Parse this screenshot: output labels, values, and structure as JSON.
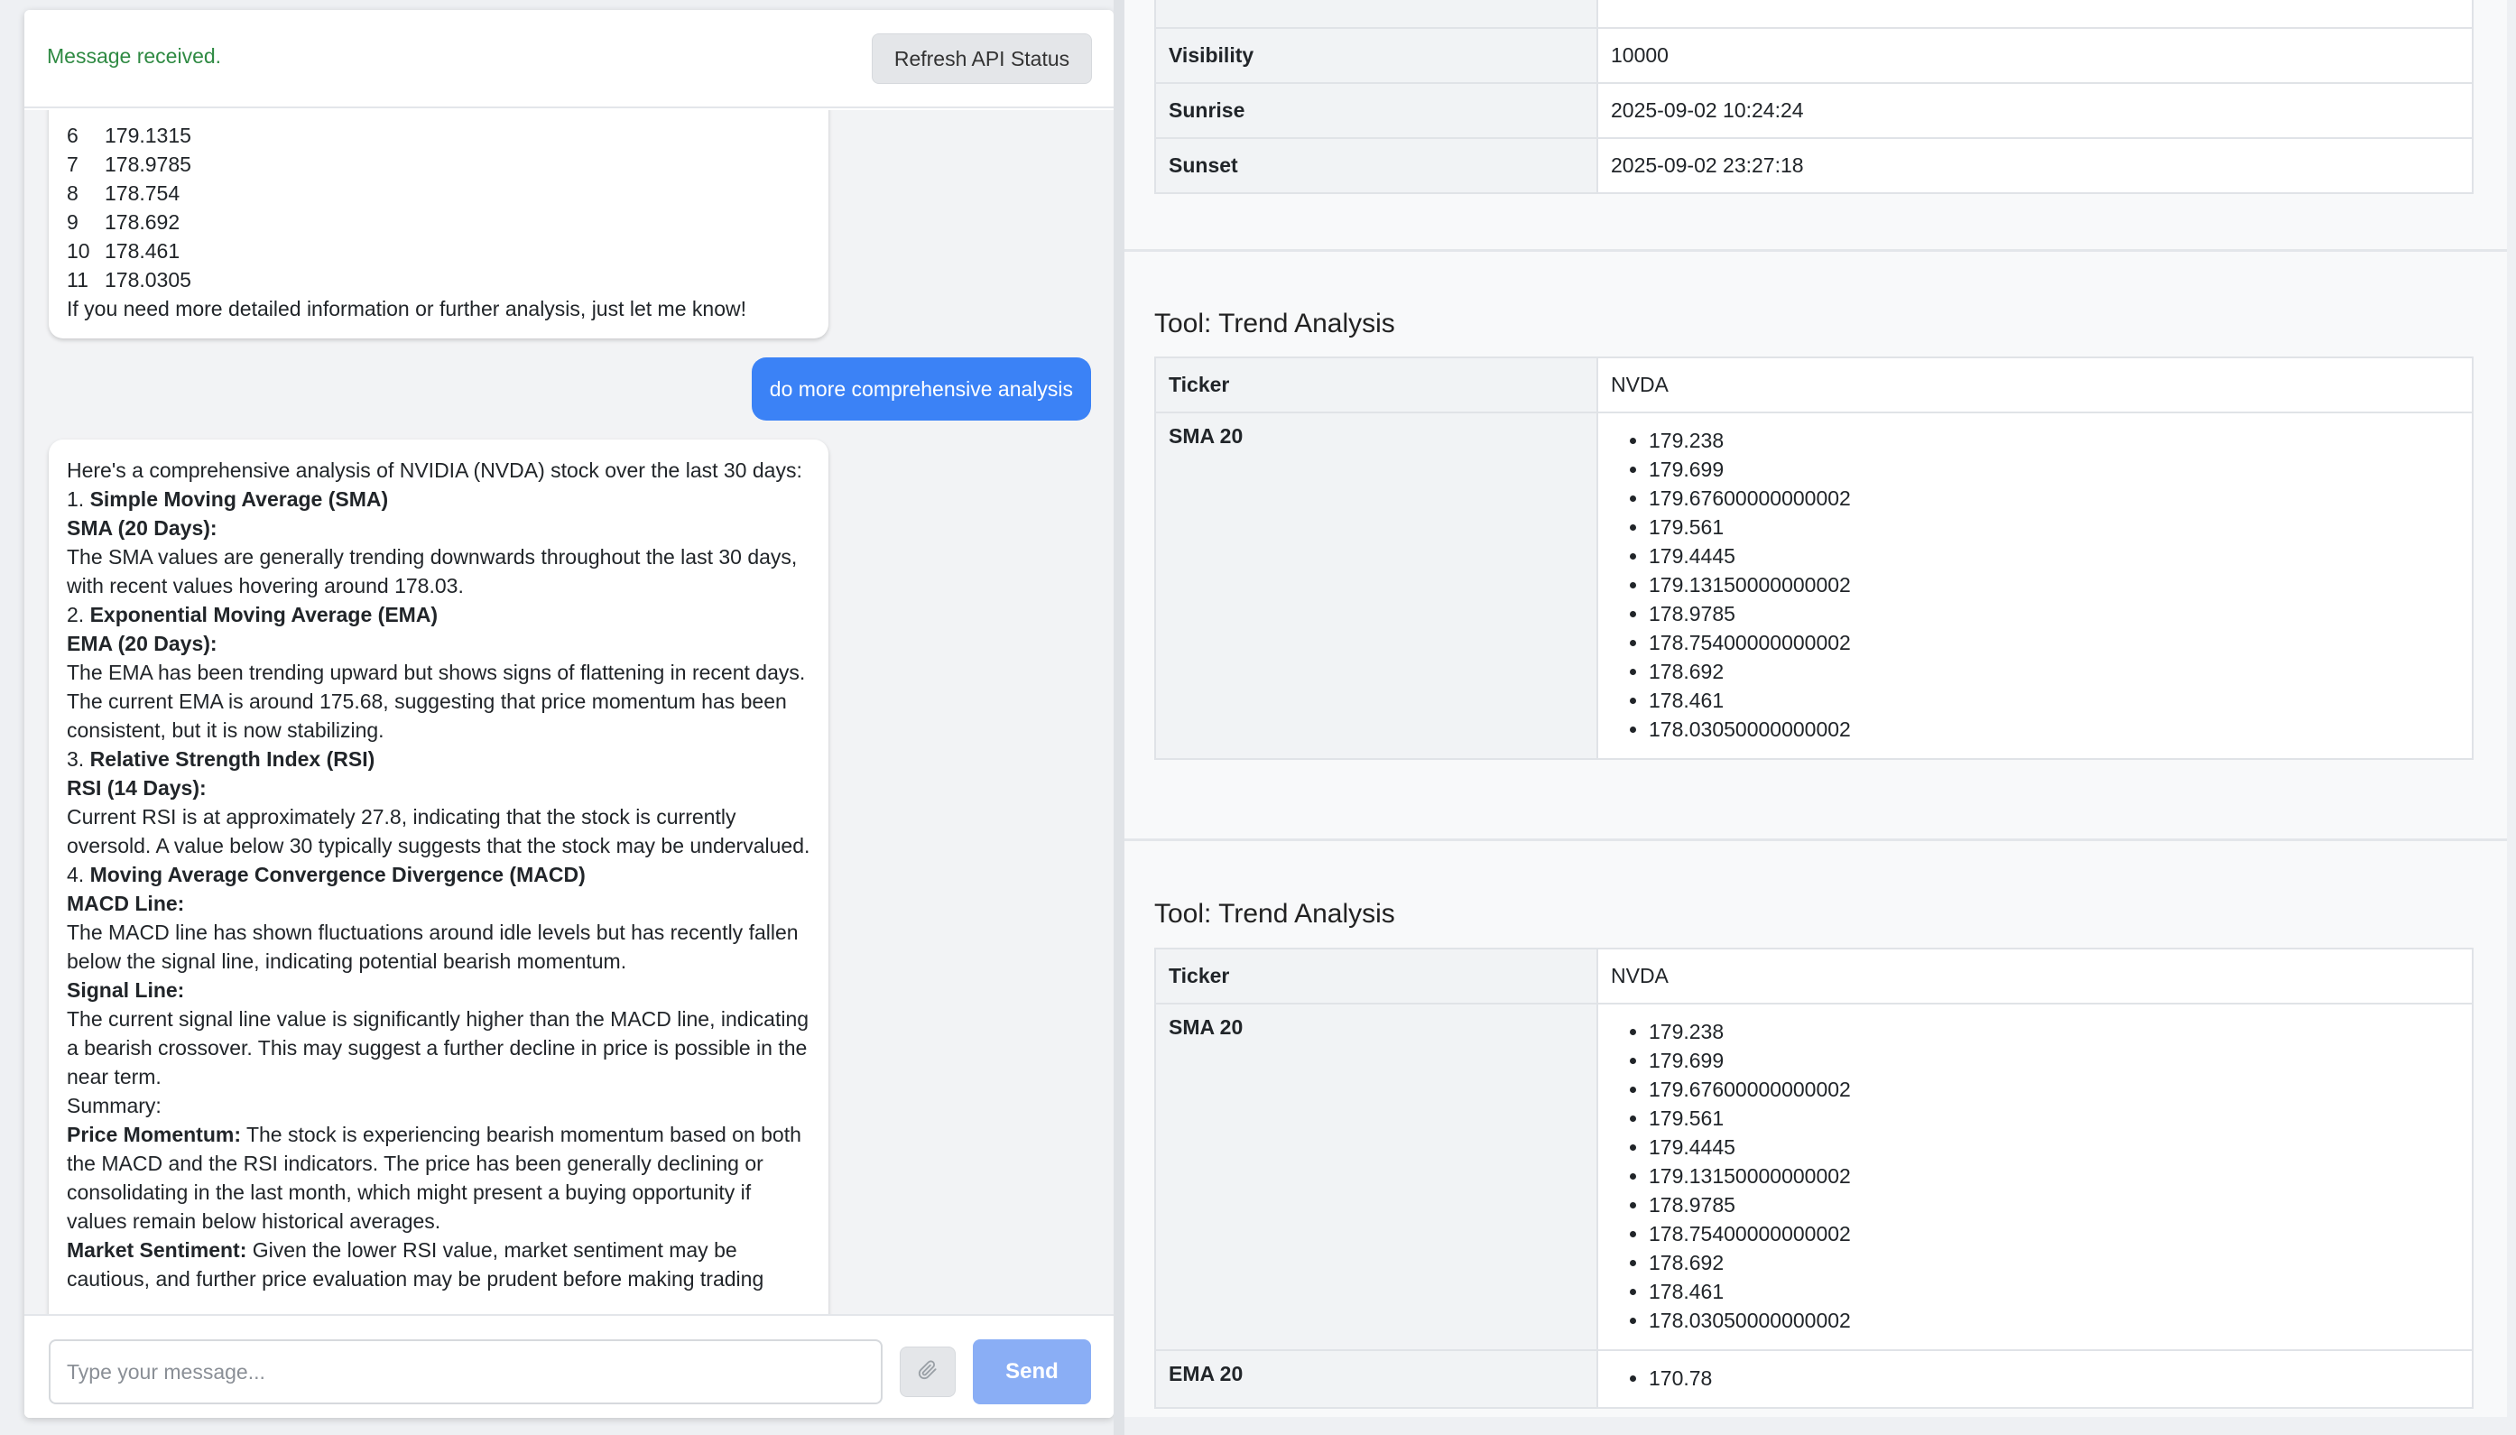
{
  "header": {
    "status_text": "Message received.",
    "refresh_label": "Refresh API Status"
  },
  "chat": {
    "bot1": {
      "rows": [
        {
          "idx": "6",
          "val": "179.1315"
        },
        {
          "idx": "7",
          "val": "178.9785"
        },
        {
          "idx": "8",
          "val": "178.754"
        },
        {
          "idx": "9",
          "val": "178.692"
        },
        {
          "idx": "10",
          "val": "178.461"
        },
        {
          "idx": "11",
          "val": "178.0305"
        }
      ],
      "closing": "If you need more detailed information or further analysis, just let me know!"
    },
    "user_message": "do more comprehensive analysis",
    "bot2": {
      "intro": "Here's a comprehensive analysis of NVIDIA (NVDA) stock over the last 30 days:",
      "s1_num": "1. ",
      "s1_title": "Simple Moving Average (SMA)",
      "s1_sub": "SMA (20 Days):",
      "s1_text": "The SMA values are generally trending downwards throughout the last 30 days, with recent values hovering around 178.03.",
      "s2_num": "2. ",
      "s2_title": "Exponential Moving Average (EMA)",
      "s2_sub": "EMA (20 Days):",
      "s2_text": "The EMA has been trending upward but shows signs of flattening in recent days. The current EMA is around 175.68, suggesting that price momentum has been consistent, but it is now stabilizing.",
      "s3_num": "3. ",
      "s3_title": "Relative Strength Index (RSI)",
      "s3_sub": "RSI (14 Days):",
      "s3_text": "Current RSI is at approximately 27.8, indicating that the stock is currently oversold. A value below 30 typically suggests that the stock may be undervalued.",
      "s4_num": "4. ",
      "s4_title": "Moving Average Convergence Divergence (MACD)",
      "s4_sub1": "MACD Line:",
      "s4_text1": "The MACD line has shown fluctuations around idle levels but has recently fallen below the signal line, indicating potential bearish momentum.",
      "s4_sub2": "Signal Line:",
      "s4_text2": "The current signal line value is significantly higher than the MACD line, indicating a bearish crossover. This may suggest a further decline in price is possible in the near term.",
      "summary_label": "Summary:",
      "pm_label": "Price Momentum:",
      "pm_text": " The stock is experiencing bearish momentum based on both the MACD and the RSI indicators. The price has been generally declining or consolidating in the last month, which might present a buying opportunity if values remain below historical averages.",
      "ms_label": "Market Sentiment:",
      "ms_text": " Given the lower RSI value, market sentiment may be cautious, and further price evaluation may be prudent before making trading"
    }
  },
  "composer": {
    "placeholder": "Type your message...",
    "send_label": "Send"
  },
  "weather": {
    "rows": [
      {
        "key": "Visibility",
        "value": "10000"
      },
      {
        "key": "Sunrise",
        "value": "2025-09-02 10:24:24"
      },
      {
        "key": "Sunset",
        "value": "2025-09-02 23:27:18"
      }
    ]
  },
  "tools": [
    {
      "title": "Tool: Trend Analysis",
      "ticker_label": "Ticker",
      "ticker": "NVDA",
      "sma_label": "SMA 20",
      "sma": [
        "179.238",
        "179.699",
        "179.67600000000002",
        "179.561",
        "179.4445",
        "179.13150000000002",
        "178.9785",
        "178.75400000000002",
        "178.692",
        "178.461",
        "178.03050000000002"
      ]
    },
    {
      "title": "Tool: Trend Analysis",
      "ticker_label": "Ticker",
      "ticker": "NVDA",
      "sma_label": "SMA 20",
      "sma": [
        "179.238",
        "179.699",
        "179.67600000000002",
        "179.561",
        "179.4445",
        "179.13150000000002",
        "178.9785",
        "178.75400000000002",
        "178.692",
        "178.461",
        "178.03050000000002"
      ],
      "ema_label": "EMA 20",
      "ema": [
        "170.78"
      ]
    }
  ]
}
